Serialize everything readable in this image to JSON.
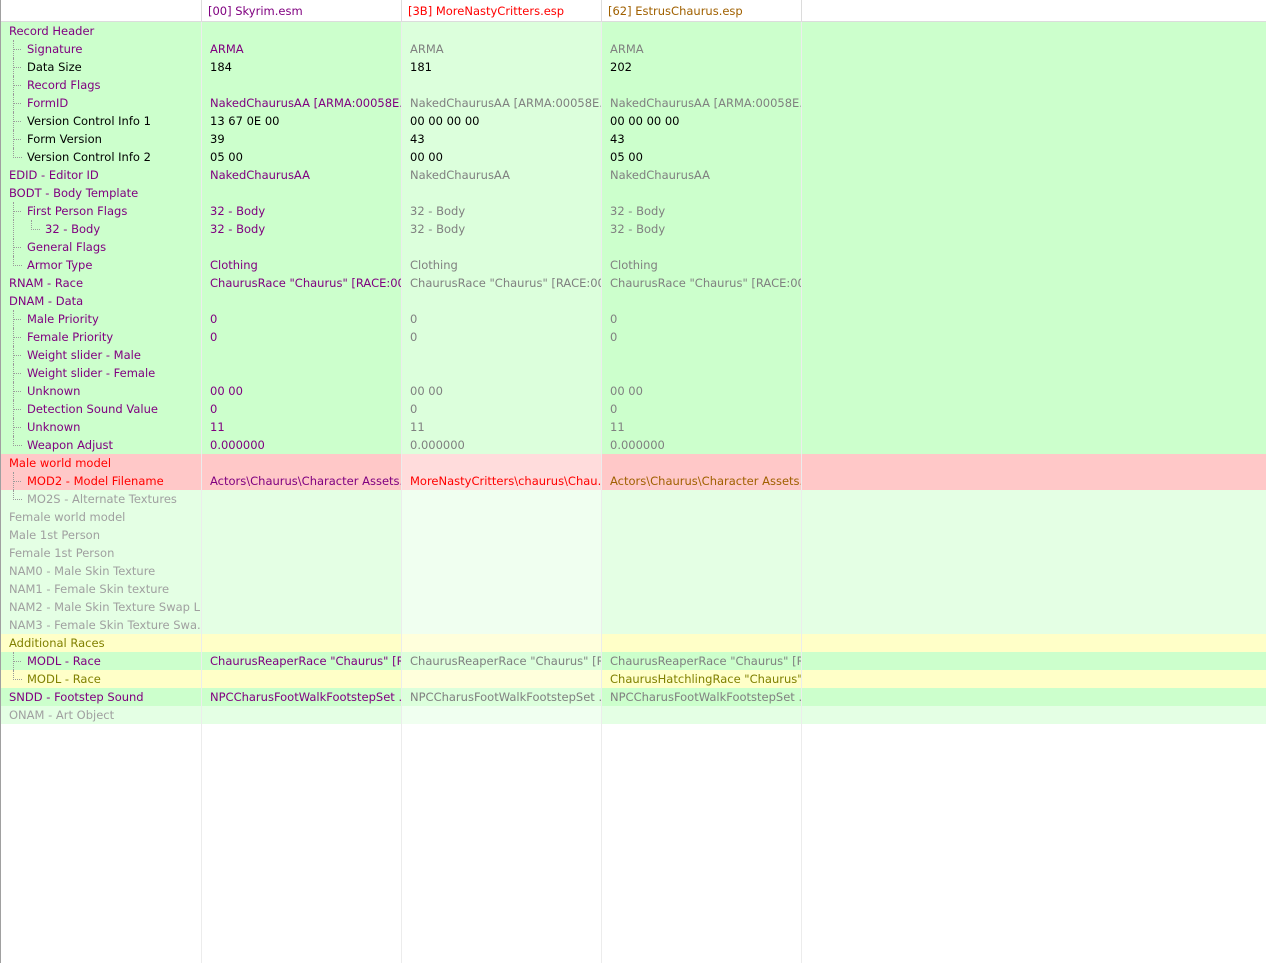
{
  "colors": {
    "conflict_green_a": "#ccffcc",
    "conflict_green_b": "#dcffdc",
    "conflict_red_a": "#ffc8c8",
    "conflict_red_b": "#ffdcdc",
    "conflict_yellow_a": "#ffffc8",
    "conflict_yellow_b": "#ffffdc",
    "empty_green_a": "#e4ffe4",
    "empty_green_b": "#f0fff0",
    "text_purple": "#800080",
    "text_red": "#ff0000",
    "text_orange": "#a06000",
    "text_gray": "#808080",
    "text_black": "#000000",
    "text_olive": "#808000",
    "text_dim": "#a0a0a0"
  },
  "header": {
    "columns": [
      {
        "label": "",
        "color": "#000000"
      },
      {
        "label": "[00] Skyrim.esm",
        "color": "#800080"
      },
      {
        "label": "[3B] MoreNastyCritters.esp",
        "color": "#ff0000"
      },
      {
        "label": "[62] EstrusChaurus.esp",
        "color": "#a06000"
      },
      {
        "label": "",
        "color": "#000000"
      }
    ]
  },
  "rows": [
    {
      "label": "Record Header",
      "depth": 0,
      "last": false,
      "bg": "green",
      "lc": "#800080",
      "v": [
        "",
        "",
        ""
      ],
      "vc": [
        "#800080",
        "#808080",
        "#808080"
      ]
    },
    {
      "label": "Signature",
      "depth": 1,
      "last": false,
      "bg": "green",
      "lc": "#800080",
      "v": [
        "ARMA",
        "ARMA",
        "ARMA"
      ],
      "vc": [
        "#800080",
        "#808080",
        "#808080"
      ]
    },
    {
      "label": "Data Size",
      "depth": 1,
      "last": false,
      "bg": "green",
      "lc": "#000000",
      "v": [
        "184",
        "181",
        "202"
      ],
      "vc": [
        "#000000",
        "#000000",
        "#000000"
      ]
    },
    {
      "label": "Record Flags",
      "depth": 1,
      "last": false,
      "bg": "green",
      "lc": "#800080",
      "v": [
        "",
        "",
        ""
      ],
      "vc": [
        "#800080",
        "#808080",
        "#808080"
      ]
    },
    {
      "label": "FormID",
      "depth": 1,
      "last": false,
      "bg": "green",
      "lc": "#800080",
      "v": [
        "NakedChaurusAA [ARMA:00058E...",
        "NakedChaurusAA [ARMA:00058E...",
        "NakedChaurusAA [ARMA:00058E..."
      ],
      "vc": [
        "#800080",
        "#808080",
        "#808080"
      ]
    },
    {
      "label": "Version Control Info 1",
      "depth": 1,
      "last": false,
      "bg": "green",
      "lc": "#000000",
      "v": [
        "13 67 0E 00",
        "00 00 00 00",
        "00 00 00 00"
      ],
      "vc": [
        "#000000",
        "#000000",
        "#000000"
      ]
    },
    {
      "label": "Form Version",
      "depth": 1,
      "last": false,
      "bg": "green",
      "lc": "#000000",
      "v": [
        "39",
        "43",
        "43"
      ],
      "vc": [
        "#000000",
        "#000000",
        "#000000"
      ]
    },
    {
      "label": "Version Control Info 2",
      "depth": 1,
      "last": true,
      "bg": "green",
      "lc": "#000000",
      "v": [
        "05 00",
        "00 00",
        "05 00"
      ],
      "vc": [
        "#000000",
        "#000000",
        "#000000"
      ]
    },
    {
      "label": "EDID - Editor ID",
      "depth": 0,
      "last": false,
      "bg": "green",
      "lc": "#800080",
      "v": [
        "NakedChaurusAA",
        "NakedChaurusAA",
        "NakedChaurusAA"
      ],
      "vc": [
        "#800080",
        "#808080",
        "#808080"
      ]
    },
    {
      "label": "BODT - Body Template",
      "depth": 0,
      "last": false,
      "bg": "green",
      "lc": "#800080",
      "v": [
        "",
        "",
        ""
      ],
      "vc": [
        "#800080",
        "#808080",
        "#808080"
      ]
    },
    {
      "label": "First Person Flags",
      "depth": 1,
      "last": false,
      "bg": "green",
      "lc": "#800080",
      "v": [
        "32 - Body",
        "32 - Body",
        "32 - Body"
      ],
      "vc": [
        "#800080",
        "#808080",
        "#808080"
      ]
    },
    {
      "label": "32 - Body",
      "depth": 2,
      "last": true,
      "bg": "green",
      "lc": "#800080",
      "v": [
        "32 - Body",
        "32 - Body",
        "32 - Body"
      ],
      "vc": [
        "#800080",
        "#808080",
        "#808080"
      ]
    },
    {
      "label": "General Flags",
      "depth": 1,
      "last": false,
      "bg": "green",
      "lc": "#800080",
      "v": [
        "",
        "",
        ""
      ],
      "vc": [
        "#800080",
        "#808080",
        "#808080"
      ]
    },
    {
      "label": "Armor Type",
      "depth": 1,
      "last": true,
      "bg": "green",
      "lc": "#800080",
      "v": [
        "Clothing",
        "Clothing",
        "Clothing"
      ],
      "vc": [
        "#800080",
        "#808080",
        "#808080"
      ]
    },
    {
      "label": "RNAM - Race",
      "depth": 0,
      "last": false,
      "bg": "green",
      "lc": "#800080",
      "v": [
        "ChaurusRace \"Chaurus\" [RACE:00...",
        "ChaurusRace \"Chaurus\" [RACE:00...",
        "ChaurusRace \"Chaurus\" [RACE:00..."
      ],
      "vc": [
        "#800080",
        "#808080",
        "#808080"
      ]
    },
    {
      "label": "DNAM - Data",
      "depth": 0,
      "last": false,
      "bg": "green",
      "lc": "#800080",
      "v": [
        "",
        "",
        ""
      ],
      "vc": [
        "#800080",
        "#808080",
        "#808080"
      ]
    },
    {
      "label": "Male Priority",
      "depth": 1,
      "last": false,
      "bg": "green",
      "lc": "#800080",
      "v": [
        "0",
        "0",
        "0"
      ],
      "vc": [
        "#800080",
        "#808080",
        "#808080"
      ]
    },
    {
      "label": "Female Priority",
      "depth": 1,
      "last": false,
      "bg": "green",
      "lc": "#800080",
      "v": [
        "0",
        "0",
        "0"
      ],
      "vc": [
        "#800080",
        "#808080",
        "#808080"
      ]
    },
    {
      "label": "Weight slider - Male",
      "depth": 1,
      "last": false,
      "bg": "green",
      "lc": "#800080",
      "v": [
        "",
        "",
        ""
      ],
      "vc": [
        "#800080",
        "#808080",
        "#808080"
      ]
    },
    {
      "label": "Weight slider - Female",
      "depth": 1,
      "last": false,
      "bg": "green",
      "lc": "#800080",
      "v": [
        "",
        "",
        ""
      ],
      "vc": [
        "#800080",
        "#808080",
        "#808080"
      ]
    },
    {
      "label": "Unknown",
      "depth": 1,
      "last": false,
      "bg": "green",
      "lc": "#800080",
      "v": [
        "00 00",
        "00 00",
        "00 00"
      ],
      "vc": [
        "#800080",
        "#808080",
        "#808080"
      ]
    },
    {
      "label": "Detection Sound Value",
      "depth": 1,
      "last": false,
      "bg": "green",
      "lc": "#800080",
      "v": [
        "0",
        "0",
        "0"
      ],
      "vc": [
        "#800080",
        "#808080",
        "#808080"
      ]
    },
    {
      "label": "Unknown",
      "depth": 1,
      "last": false,
      "bg": "green",
      "lc": "#800080",
      "v": [
        "11",
        "11",
        "11"
      ],
      "vc": [
        "#800080",
        "#808080",
        "#808080"
      ]
    },
    {
      "label": "Weapon Adjust",
      "depth": 1,
      "last": true,
      "bg": "green",
      "lc": "#800080",
      "v": [
        "0.000000",
        "0.000000",
        "0.000000"
      ],
      "vc": [
        "#800080",
        "#808080",
        "#808080"
      ]
    },
    {
      "label": "Male world model",
      "depth": 0,
      "last": false,
      "bg": "red",
      "lc": "#ff0000",
      "v": [
        "",
        "",
        ""
      ],
      "vc": [
        "#800080",
        "#ff0000",
        "#a06000"
      ]
    },
    {
      "label": "MOD2 - Model Filename",
      "depth": 1,
      "last": false,
      "bg": "red",
      "lc": "#ff0000",
      "v": [
        "Actors\\Chaurus\\Character Assets...",
        "MoreNastyCritters\\chaurus\\Chau...",
        "Actors\\Chaurus\\Character Assets..."
      ],
      "vc": [
        "#800080",
        "#ff0000",
        "#a06000"
      ]
    },
    {
      "label": "MO2S - Alternate Textures",
      "depth": 1,
      "last": true,
      "bg": "empty",
      "lc": "#a0a0a0",
      "v": [
        "",
        "",
        ""
      ],
      "vc": [
        "#a0a0a0",
        "#a0a0a0",
        "#a0a0a0"
      ]
    },
    {
      "label": "Female world model",
      "depth": 0,
      "last": false,
      "bg": "empty",
      "lc": "#a0a0a0",
      "v": [
        "",
        "",
        ""
      ],
      "vc": [
        "#a0a0a0",
        "#a0a0a0",
        "#a0a0a0"
      ]
    },
    {
      "label": "Male 1st Person",
      "depth": 0,
      "last": false,
      "bg": "empty",
      "lc": "#a0a0a0",
      "v": [
        "",
        "",
        ""
      ],
      "vc": [
        "#a0a0a0",
        "#a0a0a0",
        "#a0a0a0"
      ]
    },
    {
      "label": "Female 1st Person",
      "depth": 0,
      "last": false,
      "bg": "empty",
      "lc": "#a0a0a0",
      "v": [
        "",
        "",
        ""
      ],
      "vc": [
        "#a0a0a0",
        "#a0a0a0",
        "#a0a0a0"
      ]
    },
    {
      "label": "NAM0 - Male Skin Texture",
      "depth": 0,
      "last": false,
      "bg": "empty",
      "lc": "#a0a0a0",
      "v": [
        "",
        "",
        ""
      ],
      "vc": [
        "#a0a0a0",
        "#a0a0a0",
        "#a0a0a0"
      ]
    },
    {
      "label": "NAM1 - Female Skin texture",
      "depth": 0,
      "last": false,
      "bg": "empty",
      "lc": "#a0a0a0",
      "v": [
        "",
        "",
        ""
      ],
      "vc": [
        "#a0a0a0",
        "#a0a0a0",
        "#a0a0a0"
      ]
    },
    {
      "label": "NAM2 - Male Skin Texture Swap L...",
      "depth": 0,
      "last": false,
      "bg": "empty",
      "lc": "#a0a0a0",
      "v": [
        "",
        "",
        ""
      ],
      "vc": [
        "#a0a0a0",
        "#a0a0a0",
        "#a0a0a0"
      ]
    },
    {
      "label": "NAM3 - Female Skin Texture Swa...",
      "depth": 0,
      "last": false,
      "bg": "empty",
      "lc": "#a0a0a0",
      "v": [
        "",
        "",
        ""
      ],
      "vc": [
        "#a0a0a0",
        "#a0a0a0",
        "#a0a0a0"
      ]
    },
    {
      "label": "Additional Races",
      "depth": 0,
      "last": false,
      "bg": "yellow",
      "lc": "#808000",
      "v": [
        "",
        "",
        ""
      ],
      "vc": [
        "#800080",
        "#808080",
        "#808000"
      ]
    },
    {
      "label": "MODL - Race",
      "depth": 1,
      "last": false,
      "bg": "green",
      "lc": "#800080",
      "v": [
        "ChaurusReaperRace \"Chaurus\" [R...",
        "ChaurusReaperRace \"Chaurus\" [R...",
        "ChaurusReaperRace \"Chaurus\" [R..."
      ],
      "vc": [
        "#800080",
        "#808080",
        "#808080"
      ]
    },
    {
      "label": "MODL - Race",
      "depth": 1,
      "last": true,
      "bg": "yellow",
      "lc": "#808000",
      "v": [
        "",
        "",
        "ChaurusHatchlingRace \"Chaurus\"..."
      ],
      "vc": [
        "#808000",
        "#808000",
        "#808000"
      ]
    },
    {
      "label": "SNDD - Footstep Sound",
      "depth": 0,
      "last": false,
      "bg": "green",
      "lc": "#800080",
      "v": [
        "NPCCharusFootWalkFootstepSet ...",
        "NPCCharusFootWalkFootstepSet ...",
        "NPCCharusFootWalkFootstepSet ..."
      ],
      "vc": [
        "#800080",
        "#808080",
        "#808080"
      ]
    },
    {
      "label": "ONAM - Art Object",
      "depth": 0,
      "last": false,
      "bg": "empty",
      "lc": "#a0a0a0",
      "v": [
        "",
        "",
        ""
      ],
      "vc": [
        "#a0a0a0",
        "#a0a0a0",
        "#a0a0a0"
      ]
    }
  ]
}
